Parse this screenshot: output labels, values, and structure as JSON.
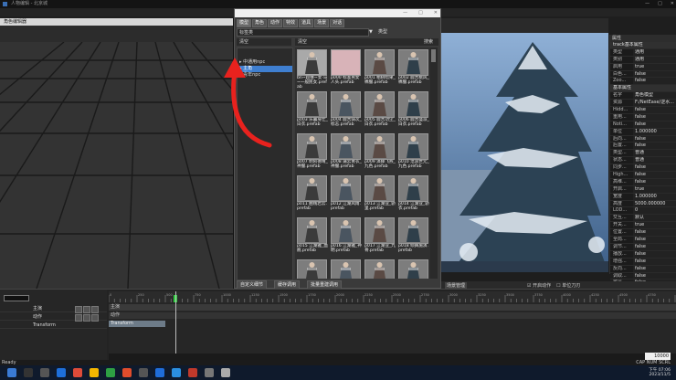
{
  "window": {
    "title": "人物编辑 - 北京城",
    "controls": [
      "—",
      "□",
      "✕"
    ]
  },
  "viewport": {
    "title": "角色编辑器"
  },
  "dialog": {
    "controls": [
      "—",
      "□",
      "✕"
    ],
    "tabs": [
      "模型",
      "角色",
      "动作",
      "特效",
      "道具",
      "场景",
      "对话"
    ],
    "dropdown_value": "标签类",
    "dropdown_arrow": "▼",
    "dropdown_label": "类型",
    "tree_clear": "清空",
    "grid_clear": "清空",
    "grid_search": "搜索",
    "tree": [
      {
        "label": "中通用npc",
        "selected": false
      },
      {
        "label": "主角",
        "selected": true
      },
      {
        "label": "青年npc",
        "selected": false
      }
    ],
    "items": [
      {
        "caption": "bn~超维~女·马~一般民女.prefab",
        "tone": "light"
      },
      {
        "caption": "p000 标准男女人头.prefab",
        "tone": "pink"
      },
      {
        "caption": "p001 柏树暗果_棉服.prefab",
        "tone": "dark"
      },
      {
        "caption": "p002 鹿苦桃风_棉服.prefab",
        "tone": "dark"
      },
      {
        "caption": "p003 乐暮身仕_白衣.prefab",
        "tone": "dark"
      },
      {
        "caption": "p004 鹿苦骑次_标志.prefab",
        "tone": "dark"
      },
      {
        "caption": "p005 鹿苦功尘_白衣.prefab",
        "tone": "dark"
      },
      {
        "caption": "p006 鹿苦盛派_白衣.prefab",
        "tone": "dark"
      },
      {
        "caption": "p007 明阿德晴_神服.prefab",
        "tone": "dark"
      },
      {
        "caption": "p008 蒲云青衣_神服.prefab",
        "tone": "dark"
      },
      {
        "caption": "p009 演绎飞燕_九色.prefab",
        "tone": "dark"
      },
      {
        "caption": "p010 沧浪世元_九色.prefab",
        "tone": "dark"
      },
      {
        "caption": "p011 曲线若云.prefab",
        "tone": "dark"
      },
      {
        "caption": "p012 江湖风雨.prefab",
        "tone": "dark"
      },
      {
        "caption": "p013 江湖亚_骄里.prefab",
        "tone": "dark"
      },
      {
        "caption": "p014 江湖亚_骄衣.prefab",
        "tone": "dark"
      },
      {
        "caption": "p015 江湖雅_血痕.prefab",
        "tone": "dark"
      },
      {
        "caption": "p016 江湖雅_神明.prefab",
        "tone": "dark"
      },
      {
        "caption": "p017 江湖亚_九骨.prefab",
        "tone": "dark"
      },
      {
        "caption": "p018 倾舞施演.prefab",
        "tone": "dark"
      },
      {
        "caption": "",
        "tone": "dark"
      },
      {
        "caption": "",
        "tone": "dark"
      },
      {
        "caption": "",
        "tone": "dark"
      },
      {
        "caption": "",
        "tone": "dark"
      }
    ],
    "footer_buttons": [
      "自定义细节",
      "缓存调用",
      "批量重建调用"
    ]
  },
  "properties": {
    "header": "属性",
    "rows": [
      {
        "k": "track基本属性",
        "v": "",
        "section": true
      },
      {
        "k": "类型",
        "v": "通用"
      },
      {
        "k": "类别",
        "v": "通用"
      },
      {
        "k": "启用",
        "v": "true"
      },
      {
        "k": "白色...",
        "v": "false"
      },
      {
        "k": "Zoo...",
        "v": "false"
      },
      {
        "k": "基本属性",
        "v": "",
        "section": true
      },
      {
        "k": "名字",
        "v": "角色模型"
      },
      {
        "k": "资源",
        "v": "F:/NetEase/逆水..."
      },
      {
        "k": "Hidd...",
        "v": "false"
      },
      {
        "k": "重用...",
        "v": "false"
      },
      {
        "k": "Noti...",
        "v": "false"
      },
      {
        "k": "单位",
        "v": "1.000000"
      },
      {
        "k": "后向...",
        "v": "false"
      },
      {
        "k": "后置...",
        "v": "false"
      },
      {
        "k": "类型...",
        "v": "普通"
      },
      {
        "k": "状态...",
        "v": "普通"
      },
      {
        "k": "同步...",
        "v": "false"
      },
      {
        "k": "High...",
        "v": "false"
      },
      {
        "k": "高维...",
        "v": "false"
      },
      {
        "k": "开启...",
        "v": "true"
      },
      {
        "k": "宽度",
        "v": "1.000000"
      },
      {
        "k": "高度",
        "v": "5000.000000"
      },
      {
        "k": "LOD...",
        "v": "0"
      },
      {
        "k": "交互...",
        "v": "默认"
      },
      {
        "k": "开关...",
        "v": "true"
      },
      {
        "k": "位置...",
        "v": "false"
      },
      {
        "k": "全局...",
        "v": "false"
      },
      {
        "k": "调节...",
        "v": "false"
      },
      {
        "k": "播放...",
        "v": "false"
      },
      {
        "k": "增强...",
        "v": "false"
      },
      {
        "k": "反向...",
        "v": "false"
      },
      {
        "k": "调取...",
        "v": "false"
      },
      {
        "k": "可见...",
        "v": "false"
      }
    ]
  },
  "scene_toolbar": {
    "button": "场景管理",
    "opt1": "开启动作",
    "opt2": "单位刀刃"
  },
  "timeline": {
    "tracks": [
      {
        "label": "主演"
      },
      {
        "label": "动作"
      },
      {
        "label": "Transform"
      }
    ],
    "clips": [
      "主演",
      "动作",
      "Transform"
    ],
    "ticks": [
      "0",
      "250",
      "500",
      "750",
      "1000",
      "1250",
      "1500",
      "1750",
      "2000",
      "2250",
      "2500",
      "2750",
      "3000",
      "3250",
      "3500",
      "3750",
      "4000",
      "4250",
      "4500",
      "4750",
      "5000"
    ],
    "end_value": "10000"
  },
  "status": {
    "left": "Ready",
    "right": "CAP  NUM  SCRL"
  },
  "taskbar": {
    "time": "下午 07:06",
    "date": "2023/11/5"
  }
}
